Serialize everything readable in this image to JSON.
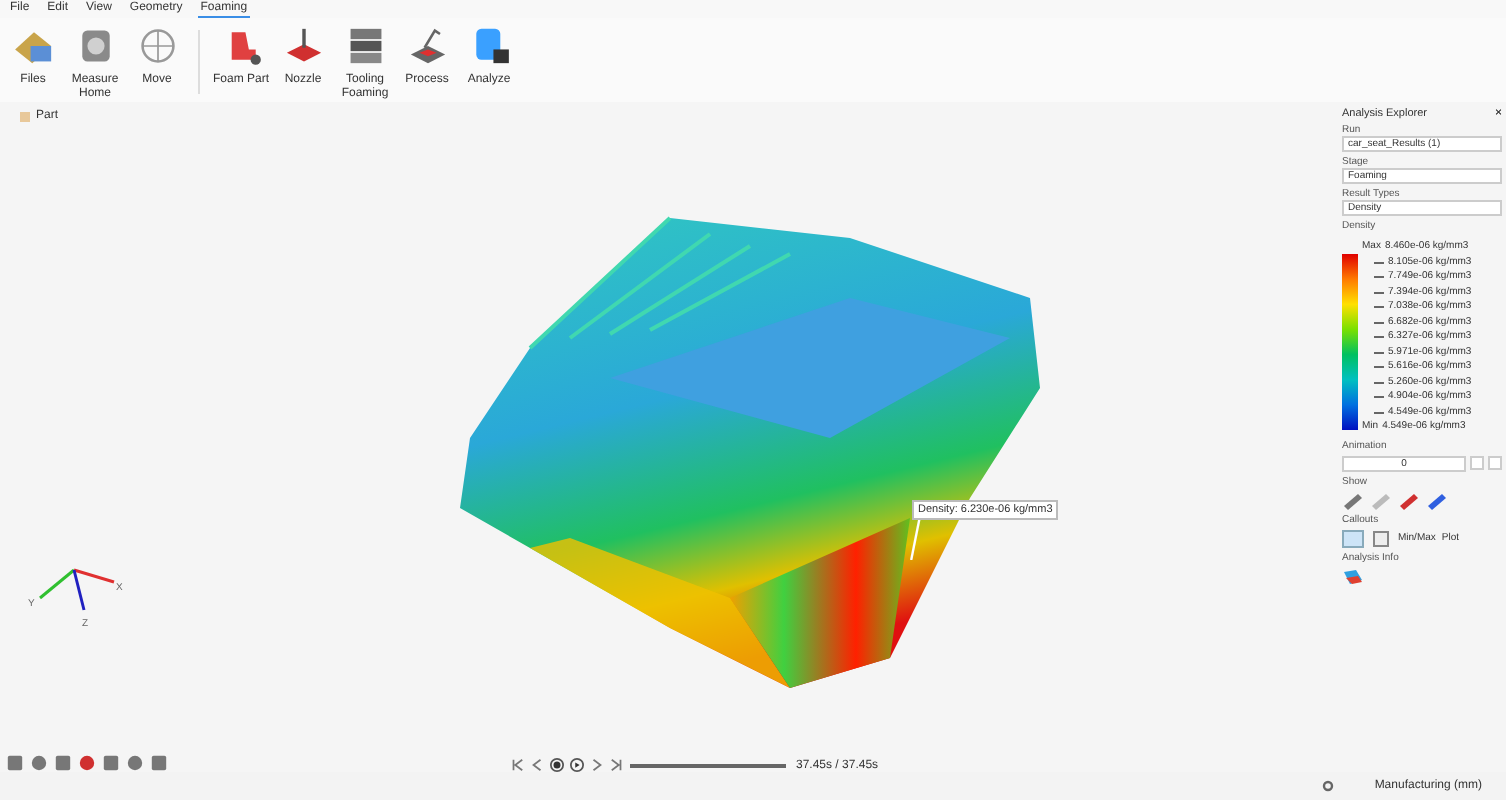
{
  "menu": [
    {
      "label": "File",
      "selected": false
    },
    {
      "label": "Edit",
      "selected": false
    },
    {
      "label": "View",
      "selected": false
    },
    {
      "label": "Geometry",
      "selected": false
    },
    {
      "label": "Foaming",
      "selected": true
    }
  ],
  "ribbon": {
    "groups": [
      [
        {
          "label": "Files"
        },
        {
          "label": "Measure Home"
        },
        {
          "label": "Move"
        }
      ],
      [
        {
          "label": "Foam Part"
        },
        {
          "label": "Nozzle"
        },
        {
          "label": "Tooling Foaming"
        },
        {
          "label": "Process"
        },
        {
          "label": "Analyze"
        }
      ]
    ]
  },
  "tree": {
    "items": [
      {
        "label": "Part"
      }
    ]
  },
  "viewport": {
    "tooltip": "Density: 6.230e-06 kg/mm3",
    "axes": [
      "X",
      "Y",
      "Z"
    ]
  },
  "explorer": {
    "title": "Analysis Explorer",
    "close": "×",
    "fields": [
      {
        "label": "Run",
        "value": "car_seat_Results (1)"
      },
      {
        "label": "Stage",
        "value": "Foaming"
      },
      {
        "label": "Result Types",
        "value": "Density"
      }
    ],
    "legend": {
      "title": "Density",
      "max_label": "Max",
      "max": "8.460e-06 kg/mm3",
      "min_label": "Min",
      "min": "4.549e-06 kg/mm3",
      "ticks": [
        "8.105e-06 kg/mm3",
        "7.749e-06 kg/mm3",
        "7.394e-06 kg/mm3",
        "7.038e-06 kg/mm3",
        "6.682e-06 kg/mm3",
        "6.327e-06 kg/mm3",
        "5.971e-06 kg/mm3",
        "5.616e-06 kg/mm3",
        "5.260e-06 kg/mm3",
        "4.904e-06 kg/mm3",
        "4.549e-06 kg/mm3"
      ]
    },
    "animation": {
      "title": "Animation",
      "value": "0"
    },
    "show": {
      "title": "Show"
    },
    "callouts": {
      "title": "Callouts",
      "min_max": "Min/Max",
      "plot": "Plot"
    },
    "analysis_info": {
      "title": "Analysis Info"
    }
  },
  "playback": {
    "time": "37.45s / 37.45s",
    "level": 1
  },
  "status": {
    "units": "Manufacturing (mm)"
  }
}
